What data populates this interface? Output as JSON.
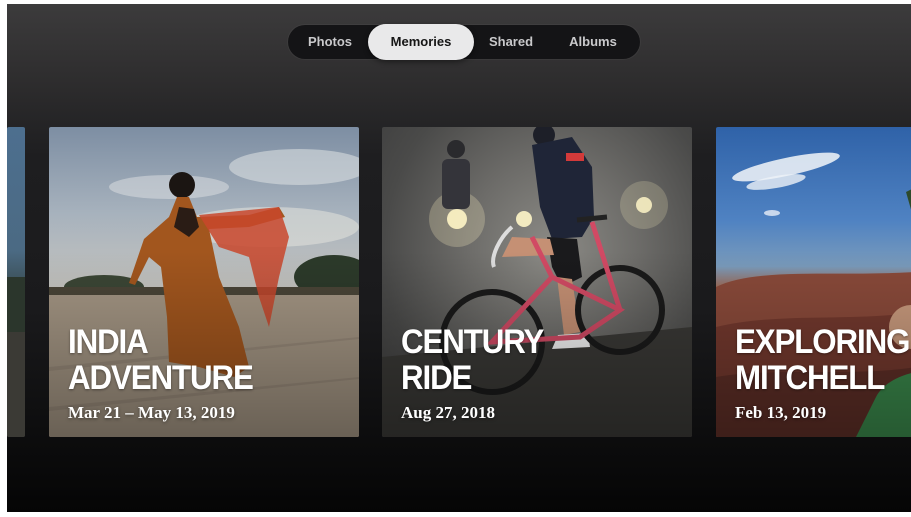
{
  "tabs": [
    {
      "label": "Photos",
      "active": false
    },
    {
      "label": "Memories",
      "active": true
    },
    {
      "label": "Shared",
      "active": false
    },
    {
      "label": "Albums",
      "active": false
    }
  ],
  "memories": [
    {
      "title_line1": "INDIA",
      "title_line2": "ADVENTURE",
      "date": "Mar 21 – May 13, 2019"
    },
    {
      "title_line1": "CENTURY",
      "title_line2": "RIDE",
      "date": "Aug 27, 2018"
    },
    {
      "title_line1": "EXPLORING",
      "title_line2": "MITCHELL",
      "date": "Feb 13, 2019"
    }
  ],
  "colors": {
    "tab_active_bg": "#e9e9ea",
    "tab_bar_bg": "#141416",
    "background": "#1a1a1c"
  }
}
